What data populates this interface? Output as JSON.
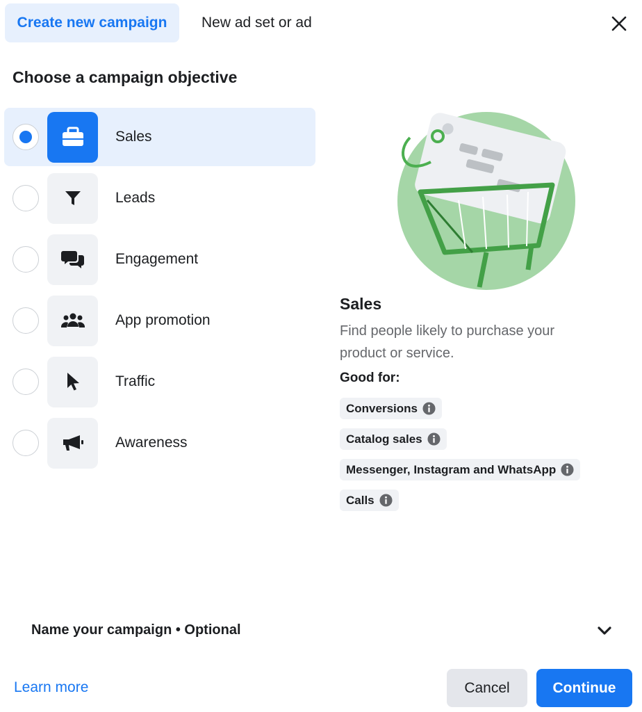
{
  "tabs": {
    "active_label": "Create new campaign",
    "inactive_label": "New ad set or ad"
  },
  "heading": "Choose a campaign objective",
  "objectives": [
    {
      "label": "Sales",
      "icon": "briefcase-icon",
      "selected": true
    },
    {
      "label": "Leads",
      "icon": "funnel-icon",
      "selected": false
    },
    {
      "label": "Engagement",
      "icon": "chat-bubbles-icon",
      "selected": false
    },
    {
      "label": "App promotion",
      "icon": "people-group-icon",
      "selected": false
    },
    {
      "label": "Traffic",
      "icon": "cursor-icon",
      "selected": false
    },
    {
      "label": "Awareness",
      "icon": "megaphone-icon",
      "selected": false
    }
  ],
  "detail": {
    "title": "Sales",
    "description": "Find people likely to purchase your product or service.",
    "good_for_label": "Good for:",
    "good_for": [
      "Conversions",
      "Catalog sales",
      "Messenger, Instagram and WhatsApp",
      "Calls"
    ]
  },
  "name_campaign_label": "Name your campaign • Optional",
  "footer": {
    "learn_more": "Learn more",
    "cancel": "Cancel",
    "continue": "Continue"
  },
  "colors": {
    "accent": "#1877f2",
    "selected_bg": "#e7f0fd",
    "illustration_green": "#a5d6a7"
  }
}
